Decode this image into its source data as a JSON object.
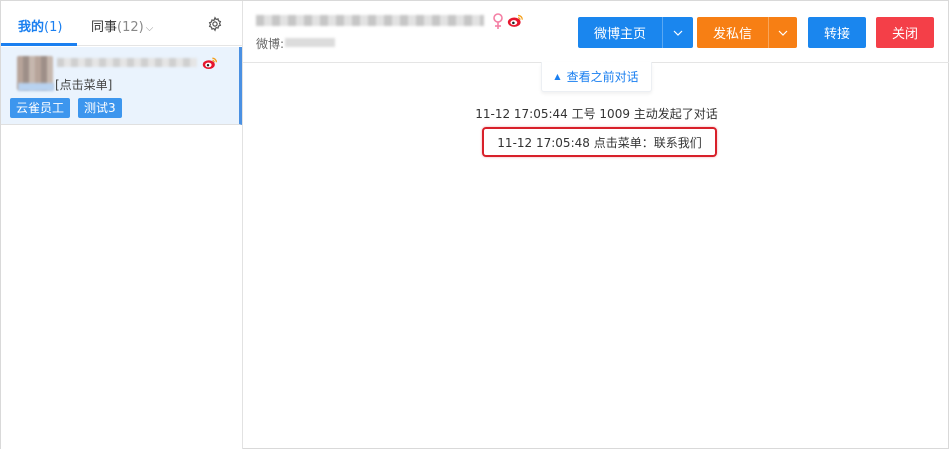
{
  "sidebar": {
    "tabs": [
      {
        "label": "我的",
        "count": "(1)"
      },
      {
        "label": "同事",
        "count": "(12)"
      }
    ],
    "conversation": {
      "last_message": "[点击菜单]",
      "tags": [
        "云雀员工",
        "测试3"
      ]
    }
  },
  "header": {
    "sub_label": "微博:",
    "buttons": {
      "weibo_home": "微博主页",
      "private_message": "发私信",
      "transfer": "转接",
      "close": "关闭"
    }
  },
  "chat": {
    "view_previous": "查看之前对话",
    "log": [
      "11-12 17:05:44 工号 1009 主动发起了对话",
      "11-12 17:05:48 点击菜单：联系我们"
    ]
  },
  "colors": {
    "accent": "#1a86ee",
    "orange": "#f77f14",
    "danger": "#f43f48",
    "highlight_border": "#d8202a",
    "tag": "#3d96ee"
  }
}
